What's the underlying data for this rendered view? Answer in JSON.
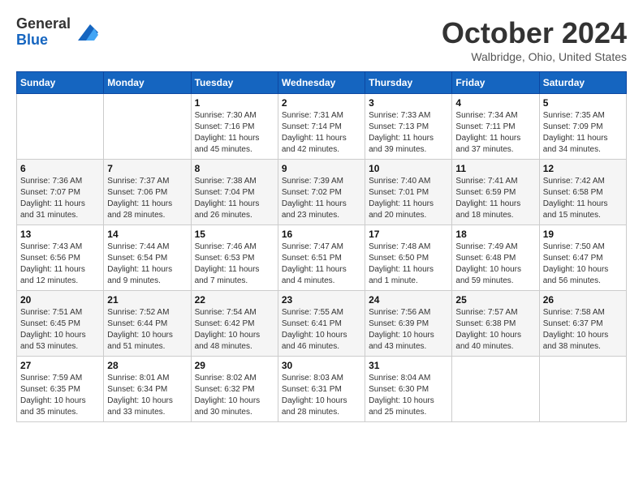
{
  "header": {
    "logo_line1": "General",
    "logo_line2": "Blue",
    "month": "October 2024",
    "location": "Walbridge, Ohio, United States"
  },
  "weekdays": [
    "Sunday",
    "Monday",
    "Tuesday",
    "Wednesday",
    "Thursday",
    "Friday",
    "Saturday"
  ],
  "weeks": [
    [
      {
        "day": "",
        "info": ""
      },
      {
        "day": "",
        "info": ""
      },
      {
        "day": "1",
        "info": "Sunrise: 7:30 AM\nSunset: 7:16 PM\nDaylight: 11 hours and 45 minutes."
      },
      {
        "day": "2",
        "info": "Sunrise: 7:31 AM\nSunset: 7:14 PM\nDaylight: 11 hours and 42 minutes."
      },
      {
        "day": "3",
        "info": "Sunrise: 7:33 AM\nSunset: 7:13 PM\nDaylight: 11 hours and 39 minutes."
      },
      {
        "day": "4",
        "info": "Sunrise: 7:34 AM\nSunset: 7:11 PM\nDaylight: 11 hours and 37 minutes."
      },
      {
        "day": "5",
        "info": "Sunrise: 7:35 AM\nSunset: 7:09 PM\nDaylight: 11 hours and 34 minutes."
      }
    ],
    [
      {
        "day": "6",
        "info": "Sunrise: 7:36 AM\nSunset: 7:07 PM\nDaylight: 11 hours and 31 minutes."
      },
      {
        "day": "7",
        "info": "Sunrise: 7:37 AM\nSunset: 7:06 PM\nDaylight: 11 hours and 28 minutes."
      },
      {
        "day": "8",
        "info": "Sunrise: 7:38 AM\nSunset: 7:04 PM\nDaylight: 11 hours and 26 minutes."
      },
      {
        "day": "9",
        "info": "Sunrise: 7:39 AM\nSunset: 7:02 PM\nDaylight: 11 hours and 23 minutes."
      },
      {
        "day": "10",
        "info": "Sunrise: 7:40 AM\nSunset: 7:01 PM\nDaylight: 11 hours and 20 minutes."
      },
      {
        "day": "11",
        "info": "Sunrise: 7:41 AM\nSunset: 6:59 PM\nDaylight: 11 hours and 18 minutes."
      },
      {
        "day": "12",
        "info": "Sunrise: 7:42 AM\nSunset: 6:58 PM\nDaylight: 11 hours and 15 minutes."
      }
    ],
    [
      {
        "day": "13",
        "info": "Sunrise: 7:43 AM\nSunset: 6:56 PM\nDaylight: 11 hours and 12 minutes."
      },
      {
        "day": "14",
        "info": "Sunrise: 7:44 AM\nSunset: 6:54 PM\nDaylight: 11 hours and 9 minutes."
      },
      {
        "day": "15",
        "info": "Sunrise: 7:46 AM\nSunset: 6:53 PM\nDaylight: 11 hours and 7 minutes."
      },
      {
        "day": "16",
        "info": "Sunrise: 7:47 AM\nSunset: 6:51 PM\nDaylight: 11 hours and 4 minutes."
      },
      {
        "day": "17",
        "info": "Sunrise: 7:48 AM\nSunset: 6:50 PM\nDaylight: 11 hours and 1 minute."
      },
      {
        "day": "18",
        "info": "Sunrise: 7:49 AM\nSunset: 6:48 PM\nDaylight: 10 hours and 59 minutes."
      },
      {
        "day": "19",
        "info": "Sunrise: 7:50 AM\nSunset: 6:47 PM\nDaylight: 10 hours and 56 minutes."
      }
    ],
    [
      {
        "day": "20",
        "info": "Sunrise: 7:51 AM\nSunset: 6:45 PM\nDaylight: 10 hours and 53 minutes."
      },
      {
        "day": "21",
        "info": "Sunrise: 7:52 AM\nSunset: 6:44 PM\nDaylight: 10 hours and 51 minutes."
      },
      {
        "day": "22",
        "info": "Sunrise: 7:54 AM\nSunset: 6:42 PM\nDaylight: 10 hours and 48 minutes."
      },
      {
        "day": "23",
        "info": "Sunrise: 7:55 AM\nSunset: 6:41 PM\nDaylight: 10 hours and 46 minutes."
      },
      {
        "day": "24",
        "info": "Sunrise: 7:56 AM\nSunset: 6:39 PM\nDaylight: 10 hours and 43 minutes."
      },
      {
        "day": "25",
        "info": "Sunrise: 7:57 AM\nSunset: 6:38 PM\nDaylight: 10 hours and 40 minutes."
      },
      {
        "day": "26",
        "info": "Sunrise: 7:58 AM\nSunset: 6:37 PM\nDaylight: 10 hours and 38 minutes."
      }
    ],
    [
      {
        "day": "27",
        "info": "Sunrise: 7:59 AM\nSunset: 6:35 PM\nDaylight: 10 hours and 35 minutes."
      },
      {
        "day": "28",
        "info": "Sunrise: 8:01 AM\nSunset: 6:34 PM\nDaylight: 10 hours and 33 minutes."
      },
      {
        "day": "29",
        "info": "Sunrise: 8:02 AM\nSunset: 6:32 PM\nDaylight: 10 hours and 30 minutes."
      },
      {
        "day": "30",
        "info": "Sunrise: 8:03 AM\nSunset: 6:31 PM\nDaylight: 10 hours and 28 minutes."
      },
      {
        "day": "31",
        "info": "Sunrise: 8:04 AM\nSunset: 6:30 PM\nDaylight: 10 hours and 25 minutes."
      },
      {
        "day": "",
        "info": ""
      },
      {
        "day": "",
        "info": ""
      }
    ]
  ]
}
